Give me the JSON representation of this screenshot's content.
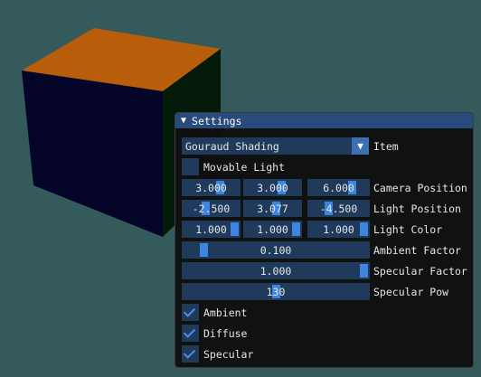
{
  "window": {
    "title": "Settings",
    "collapse_icon": "triangle-down-icon"
  },
  "item": {
    "selected": "Gouraud Shading",
    "label": "Item"
  },
  "movable_light": {
    "label": "Movable Light",
    "checked": false
  },
  "camera_position": {
    "label": "Camera Position",
    "values": [
      "3.000",
      "3.000",
      "6.000"
    ]
  },
  "light_position": {
    "label": "Light Position",
    "values": [
      "-2.500",
      "3.077",
      "-4.500"
    ]
  },
  "light_color": {
    "label": "Light Color",
    "values": [
      "1.000",
      "1.000",
      "1.000"
    ]
  },
  "ambient_factor": {
    "label": "Ambient Factor",
    "value": "0.100",
    "fraction": 0.1
  },
  "specular_factor": {
    "label": "Specular Factor",
    "value": "1.000",
    "fraction": 1.0
  },
  "specular_pow": {
    "label": "Specular Pow",
    "value": "130",
    "fraction": 0.5
  },
  "ambient": {
    "label": "Ambient",
    "checked": true
  },
  "diffuse": {
    "label": "Diffuse",
    "checked": true
  },
  "specular": {
    "label": "Specular",
    "checked": true
  },
  "colors": {
    "background": "#345a5b",
    "accent": "#3d85e0",
    "frame": "#1f3a5a",
    "title_bar": "#294a7a",
    "cube_top": "#b85e0a",
    "cube_left": "#05052a",
    "cube_right": "#041a08"
  }
}
